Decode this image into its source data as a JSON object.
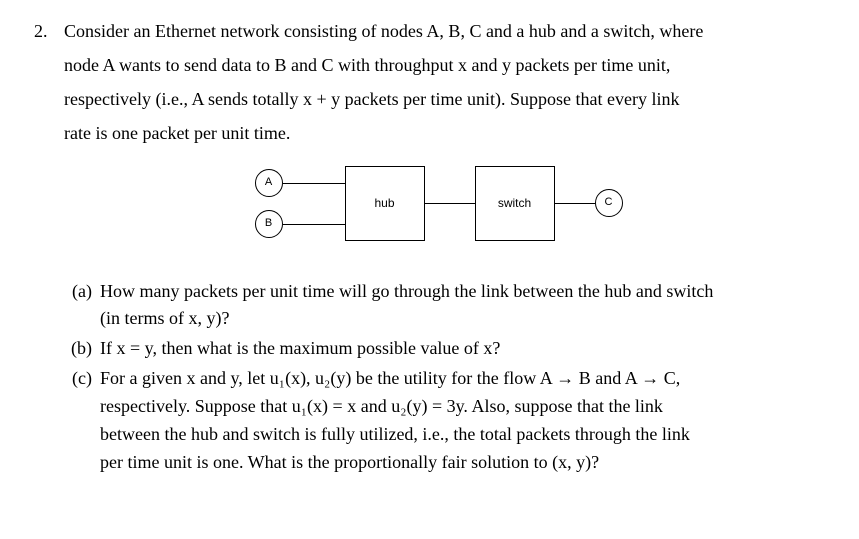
{
  "question": {
    "number": "2.",
    "text_l1": "Consider an Ethernet network consisting of nodes A, B, C and a hub and a switch, where",
    "text_l2": "node A wants to send data to B and C with throughput x and y packets per time unit,",
    "text_l3": "respectively (i.e., A sends totally x + y packets per time unit). Suppose that every link",
    "text_l4": "rate is one packet per unit time."
  },
  "diagram": {
    "nodeA": "A",
    "nodeB": "B",
    "nodeC": "C",
    "hub": "hub",
    "switch": "switch"
  },
  "parts": {
    "a": {
      "label": "(a)",
      "l1": "How many packets per unit time will go through the link between the hub and switch",
      "l2": "(in terms of x, y)?"
    },
    "b": {
      "label": "(b)",
      "l1": "If x = y, then what is the maximum possible value of x?"
    },
    "c": {
      "label": "(c)",
      "l1": "For a given x and y, let u₁(x), u₂(y) be the utility for the flow A → B and A → C,",
      "l2": "respectively. Suppose that u₁(x) = x and u₂(y) = 3y. Also, suppose that the link",
      "l3": "between the hub and switch is fully utilized, i.e., the total packets through the link",
      "l4": "per time unit is one. What is the proportionally fair solution to (x, y)?"
    }
  }
}
